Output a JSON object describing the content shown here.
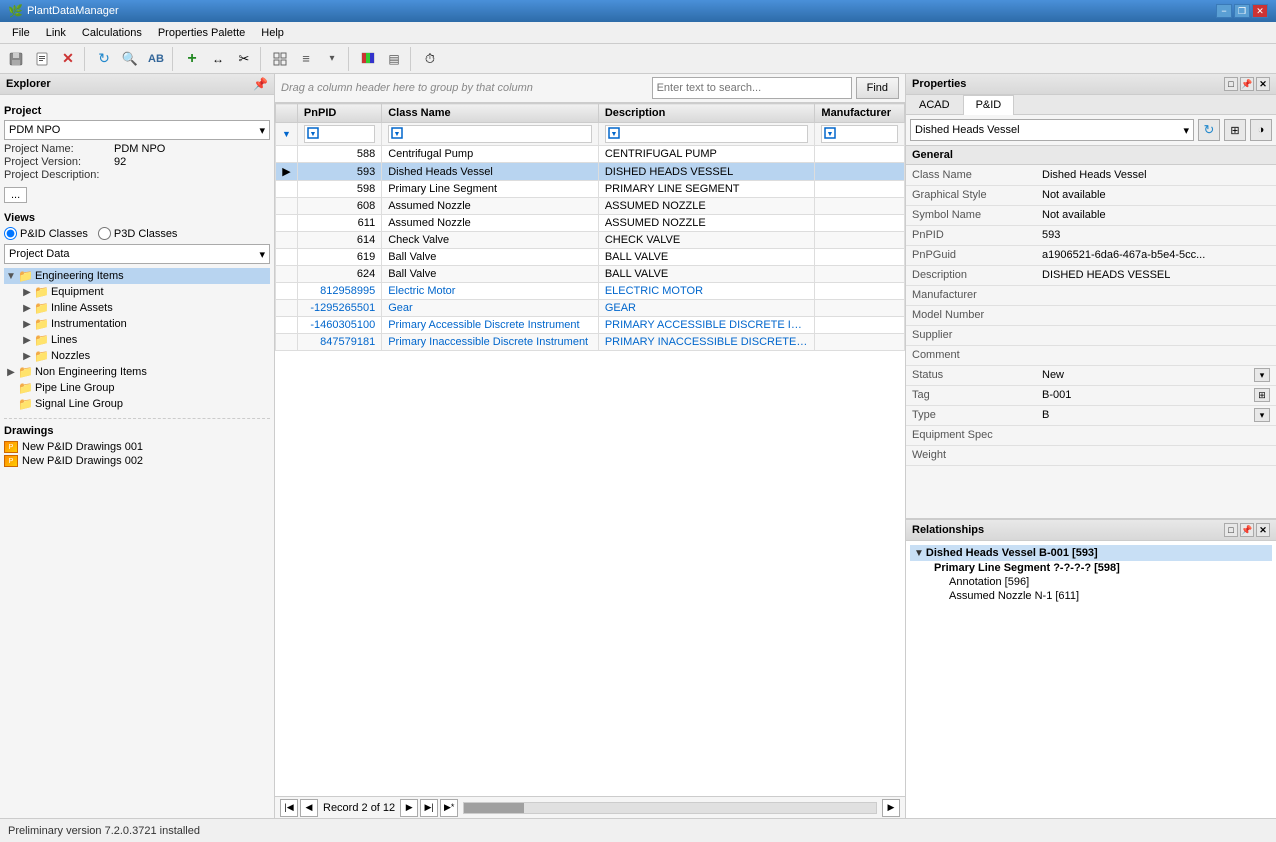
{
  "app": {
    "title": "PlantDataManager"
  },
  "titlebar": {
    "title": "PlantDataManager",
    "min_label": "−",
    "restore_label": "❒",
    "close_label": "✕"
  },
  "menubar": {
    "items": [
      "File",
      "Link",
      "Calculations",
      "Properties Palette",
      "Help"
    ]
  },
  "toolbar": {
    "buttons": [
      "💾",
      "📄",
      "✕",
      "🔄",
      "🔍",
      "🔤",
      "➕",
      "↔",
      "✂",
      "📋",
      "📌",
      "▦",
      "▤",
      "⏱"
    ]
  },
  "explorer": {
    "title": "Explorer",
    "project_section": "Project",
    "project_name_label": "Project Name:",
    "project_name_value": "PDM NPO",
    "project_version_label": "Project Version:",
    "project_version_value": "92",
    "project_desc_label": "Project Description:",
    "project_dropdown": "PDM NPO",
    "dots_btn": "...",
    "views_label": "Views",
    "view_pid": "P&ID Classes",
    "view_p3d": "P3D Classes",
    "project_data_label": "Project Data",
    "tree_items": [
      {
        "id": "engineering",
        "label": "Engineering Items",
        "level": 0,
        "expanded": true,
        "selected": true
      },
      {
        "id": "equipment",
        "label": "Equipment",
        "level": 1,
        "expanded": false
      },
      {
        "id": "inline-assets",
        "label": "Inline Assets",
        "level": 1,
        "expanded": false
      },
      {
        "id": "instrumentation",
        "label": "Instrumentation",
        "level": 1,
        "expanded": false
      },
      {
        "id": "lines",
        "label": "Lines",
        "level": 1,
        "expanded": false
      },
      {
        "id": "nozzles",
        "label": "Nozzles",
        "level": 1,
        "expanded": false
      },
      {
        "id": "non-engineering",
        "label": "Non Engineering Items",
        "level": 0,
        "expanded": false
      },
      {
        "id": "pipeline-group",
        "label": "Pipe Line Group",
        "level": 0,
        "expanded": false,
        "noexpander": true
      },
      {
        "id": "signal-group",
        "label": "Signal Line Group",
        "level": 0,
        "expanded": false,
        "noexpander": true
      }
    ],
    "drawings_section": "Drawings",
    "drawings": [
      {
        "label": "New P&ID Drawings 001"
      },
      {
        "label": "New P&ID Drawings 002"
      }
    ]
  },
  "datagrid": {
    "drag_hint": "Drag a column header here to group by that column",
    "search_placeholder": "Enter text to search...",
    "find_btn": "Find",
    "columns": [
      "PnPID",
      "Class Name",
      "Description",
      "Manufacturer"
    ],
    "rows": [
      {
        "pnpid": "588",
        "classname": "Centrifugal Pump",
        "description": "CENTRIFUGAL PUMP",
        "manufacturer": "",
        "selected": false,
        "link": false
      },
      {
        "pnpid": "593",
        "classname": "Dished Heads Vessel",
        "description": "DISHED HEADS VESSEL",
        "manufacturer": "",
        "selected": true,
        "link": false,
        "arrow": true
      },
      {
        "pnpid": "598",
        "classname": "Primary Line Segment",
        "description": "PRIMARY LINE SEGMENT",
        "manufacturer": "",
        "selected": false,
        "link": false
      },
      {
        "pnpid": "608",
        "classname": "Assumed Nozzle",
        "description": "ASSUMED NOZZLE",
        "manufacturer": "",
        "selected": false,
        "link": false
      },
      {
        "pnpid": "611",
        "classname": "Assumed Nozzle",
        "description": "ASSUMED NOZZLE",
        "manufacturer": "",
        "selected": false,
        "link": false
      },
      {
        "pnpid": "614",
        "classname": "Check Valve",
        "description": "CHECK VALVE",
        "manufacturer": "",
        "selected": false,
        "link": false
      },
      {
        "pnpid": "619",
        "classname": "Ball Valve",
        "description": "BALL VALVE",
        "manufacturer": "",
        "selected": false,
        "link": false
      },
      {
        "pnpid": "624",
        "classname": "Ball Valve",
        "description": "BALL VALVE",
        "manufacturer": "",
        "selected": false,
        "link": false
      },
      {
        "pnpid": "812958995",
        "classname": "Electric Motor",
        "description": "ELECTRIC MOTOR",
        "manufacturer": "",
        "selected": false,
        "link": true
      },
      {
        "pnpid": "-1295265501",
        "classname": "Gear",
        "description": "GEAR",
        "manufacturer": "",
        "selected": false,
        "link": true
      },
      {
        "pnpid": "-1460305100",
        "classname": "Primary Accessible Discrete Instrument",
        "description": "PRIMARY ACCESSIBLE DISCRETE INSTRUMENT",
        "manufacturer": "",
        "selected": false,
        "link": true
      },
      {
        "pnpid": "847579181",
        "classname": "Primary Inaccessible Discrete Instrument",
        "description": "PRIMARY INACCESSIBLE DISCRETE INSTRUMENT",
        "manufacturer": "",
        "selected": false,
        "link": true
      }
    ],
    "footer": {
      "record_text": "Record 2 of 12"
    }
  },
  "properties": {
    "title": "Properties",
    "tabs": [
      "ACAD",
      "P&ID"
    ],
    "active_tab": "P&ID",
    "class_dropdown": "Dished Heads Vessel",
    "general_section": "General",
    "props": [
      {
        "name": "Class Name",
        "value": "Dished Heads Vessel",
        "type": "text"
      },
      {
        "name": "Graphical Style",
        "value": "Not available",
        "type": "text"
      },
      {
        "name": "Symbol Name",
        "value": "Not available",
        "type": "text"
      },
      {
        "name": "PnPID",
        "value": "593",
        "type": "text"
      },
      {
        "name": "PnPGuid",
        "value": "a1906521-6da6-467a-b5e4-5cc...",
        "type": "text"
      },
      {
        "name": "Description",
        "value": "DISHED HEADS VESSEL",
        "type": "text"
      },
      {
        "name": "Manufacturer",
        "value": "",
        "type": "text"
      },
      {
        "name": "Model Number",
        "value": "",
        "type": "text"
      },
      {
        "name": "Supplier",
        "value": "",
        "type": "text"
      },
      {
        "name": "Comment",
        "value": "",
        "type": "text"
      },
      {
        "name": "Status",
        "value": "New",
        "type": "dropdown"
      },
      {
        "name": "Tag",
        "value": "B-001",
        "type": "button"
      },
      {
        "name": "Type",
        "value": "B",
        "type": "dropdown"
      },
      {
        "name": "Equipment Spec",
        "value": "",
        "type": "text"
      },
      {
        "name": "Weight",
        "value": "",
        "type": "text"
      }
    ]
  },
  "relationships": {
    "title": "Relationships",
    "items": [
      {
        "label": "Dished Heads Vessel B-001 [593]",
        "level": 0,
        "expanded": true
      },
      {
        "label": "Primary Line Segment ?-?-?-? [598]",
        "level": 1,
        "bold": true
      },
      {
        "label": "Annotation [596]",
        "level": 2
      },
      {
        "label": "Assumed Nozzle N-1 [611]",
        "level": 2
      }
    ]
  },
  "statusbar": {
    "text": "Preliminary version 7.2.0.3721 installed"
  },
  "colors": {
    "accent_blue": "#4a90d9",
    "link_blue": "#0066cc",
    "selected_row": "#b8d4f0",
    "header_bg": "#e8e8e8"
  }
}
